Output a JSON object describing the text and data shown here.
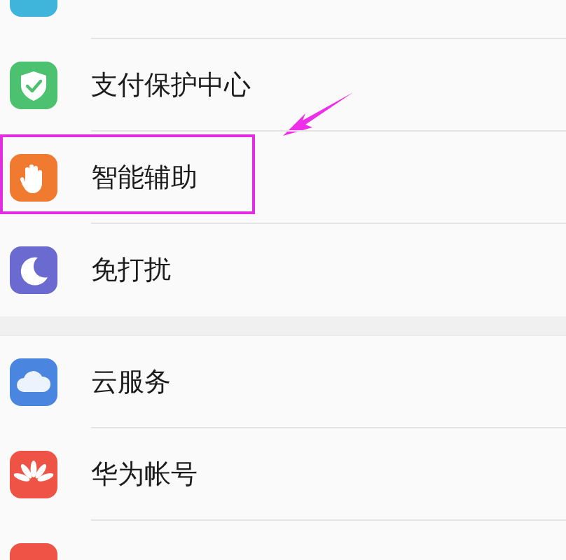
{
  "groups": [
    {
      "items": [
        {
          "kind": "blank",
          "color": "#3fb5dc",
          "highlighted": false
        },
        {
          "kind": "shield",
          "color": "#4cc170",
          "label": "支付保护中心",
          "highlighted": false
        },
        {
          "kind": "hand",
          "color": "#f07a30",
          "label": "智能辅助",
          "highlighted": true
        },
        {
          "kind": "moon",
          "color": "#6a6ad0",
          "label": "免打扰",
          "highlighted": false
        }
      ]
    },
    {
      "items": [
        {
          "kind": "cloud",
          "color": "#4a86e0",
          "label": "云服务",
          "highlighted": false
        },
        {
          "kind": "petals",
          "color": "#ef5345",
          "label": "华为帐号",
          "highlighted": false
        },
        {
          "kind": "blank",
          "color": "#ef5345",
          "highlighted": false
        }
      ]
    }
  ]
}
